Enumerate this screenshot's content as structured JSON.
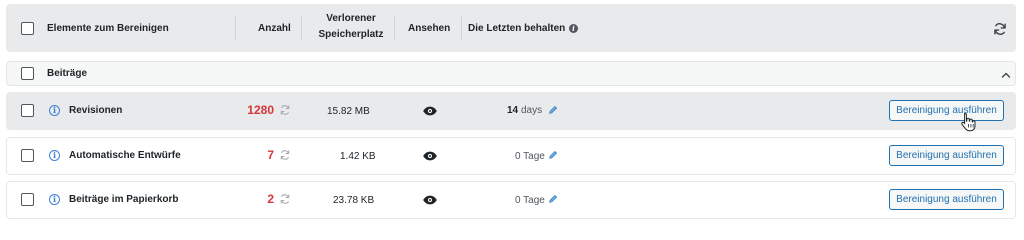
{
  "header": {
    "col_items": "Elemente zum Bereinigen",
    "col_count": "Anzahl",
    "col_space_line1": "Verlorener",
    "col_space_line2": "Speicherplatz",
    "col_view": "Ansehen",
    "col_keep": "Die Letzten behalten",
    "hint_icon_glyph": "i",
    "refresh_icon": "refresh-icon"
  },
  "group": {
    "label": "Beiträge",
    "chevron_icon": "chevron-up-icon"
  },
  "rows": [
    {
      "label": "Revisionen",
      "count": "1280",
      "size": "15.82 MB",
      "keep_number": "14",
      "keep_unit": "days",
      "action": "Bereinigung ausführen"
    },
    {
      "label": "Automatische Entwürfe",
      "count": "7",
      "size": "1.42 KB",
      "keep_number": "",
      "keep_unit": "0 Tage",
      "action": "Bereinigung ausführen"
    },
    {
      "label": "Beiträge im Papierkorb",
      "count": "2",
      "size": "23.78 KB",
      "keep_number": "",
      "keep_unit": "0 Tage",
      "action": "Bereinigung ausführen"
    }
  ],
  "colors": {
    "count_red": "#d63638",
    "accent_blue": "#2271b1",
    "info_blue": "#3b82d6"
  }
}
